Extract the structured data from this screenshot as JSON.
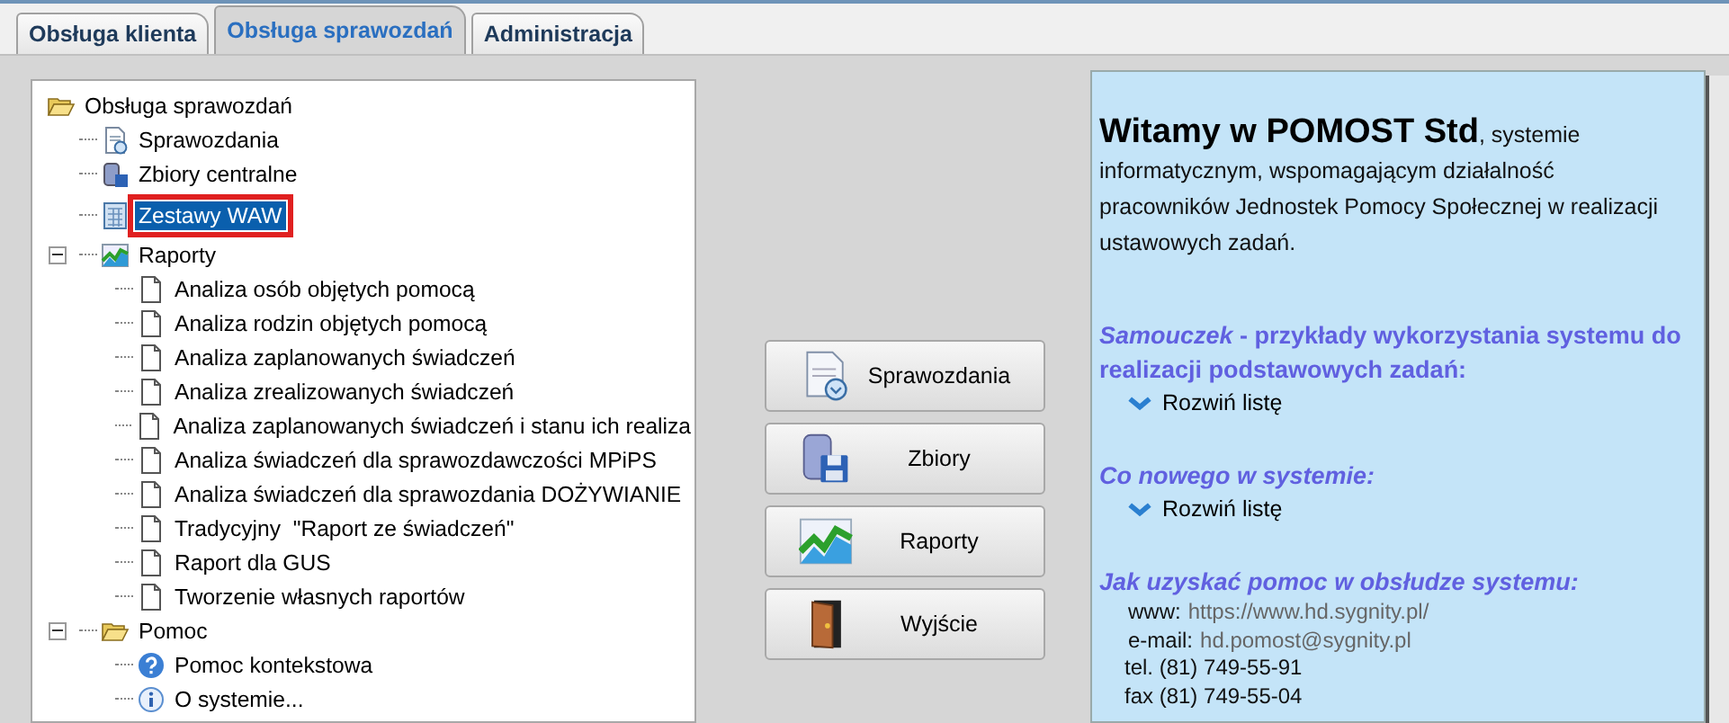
{
  "tabs": [
    {
      "label": "Obsługa klienta",
      "selected": false
    },
    {
      "label": "Obsługa sprawozdań",
      "selected": true
    },
    {
      "label": "Administracja",
      "selected": false
    }
  ],
  "tree": {
    "label": "Obsługa sprawozdań",
    "kind": "folder",
    "children": [
      {
        "label": "Sprawozdania",
        "kind": "report",
        "selected": false
      },
      {
        "label": "Zbiory centralne",
        "kind": "database",
        "selected": false
      },
      {
        "label": "Zestawy WAW",
        "kind": "calculator",
        "selected": true,
        "highlighted": true
      },
      {
        "label": "Raporty",
        "kind": "chart",
        "expanded": true,
        "selected": false,
        "children": [
          {
            "label": "Analiza osób objętych pomocą",
            "kind": "page",
            "selected": false
          },
          {
            "label": "Analiza rodzin objętych pomocą",
            "kind": "page",
            "selected": false
          },
          {
            "label": "Analiza zaplanowanych świadczeń",
            "kind": "page",
            "selected": false
          },
          {
            "label": "Analiza zrealizowanych świadczeń",
            "kind": "page",
            "selected": false
          },
          {
            "label": "Analiza zaplanowanych świadczeń i stanu ich realiza",
            "kind": "page",
            "selected": false
          },
          {
            "label": "Analiza świadczeń dla sprawozdawczości MPiPS",
            "kind": "page",
            "selected": false
          },
          {
            "label": "Analiza świadczeń dla sprawozdania DOŻYWIANIE",
            "kind": "page",
            "selected": false
          },
          {
            "label": "Tradycyjny  \"Raport ze świadczeń\"",
            "kind": "page",
            "selected": false
          },
          {
            "label": "Raport dla GUS",
            "kind": "page",
            "selected": false
          },
          {
            "label": "Tworzenie własnych raportów",
            "kind": "page",
            "selected": false
          }
        ]
      },
      {
        "label": "Pomoc",
        "kind": "folder",
        "expanded": true,
        "selected": false,
        "children": [
          {
            "label": "Pomoc kontekstowa",
            "kind": "help",
            "selected": false
          },
          {
            "label": "O systemie...",
            "kind": "info",
            "selected": false
          }
        ]
      }
    ]
  },
  "buttons": [
    {
      "label": "Sprawozdania",
      "kind": "report"
    },
    {
      "label": "Zbiory",
      "kind": "database"
    },
    {
      "label": "Raporty",
      "kind": "chart"
    },
    {
      "label": "Wyjście",
      "kind": "door"
    }
  ],
  "welcome": {
    "intro": "**Witamy w POMOST Std**, systemie informatycznym, wspomagającym działalność pracowników Jednostek Pomocy Społecznej w realizacji ustawowych zadań.",
    "sections": [
      {
        "title": "*Samouczek* - przykłady wykorzystania systemu do realizacji podstawowych zadań:",
        "link": "Rozwiń listę"
      },
      {
        "title": "*Co nowego w systemie:*",
        "link": "Rozwiń listę"
      }
    ],
    "help_title": "*Jak uzyskać pomoc w obsłudze systemu:*",
    "contacts": [
      {
        "label": "www:",
        "value": "https://www.hd.sygnity.pl/"
      },
      {
        "label": "e-mail:",
        "value": "hd.pomost@sygnity.pl"
      },
      {
        "label": "tel. (81) 749-55-91"
      },
      {
        "label": "fax (81) 749-55-04"
      }
    ]
  }
}
